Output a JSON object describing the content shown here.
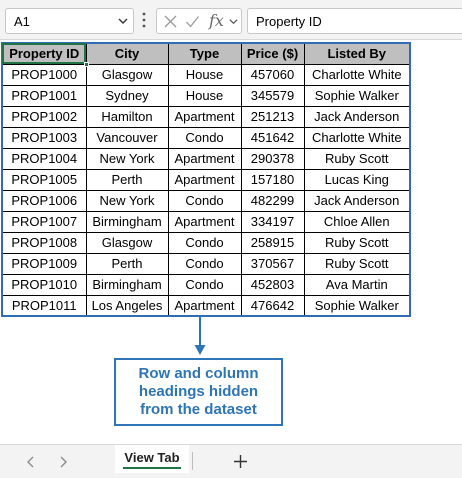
{
  "formula_bar": {
    "name_box": "A1",
    "formula": "Property ID",
    "fx_label": "fx"
  },
  "table": {
    "headers": [
      "Property ID",
      "City",
      "Type",
      "Price ($)",
      "Listed By"
    ],
    "rows": [
      [
        "PROP1000",
        "Glasgow",
        "House",
        "457060",
        "Charlotte White"
      ],
      [
        "PROP1001",
        "Sydney",
        "House",
        "345579",
        "Sophie Walker"
      ],
      [
        "PROP1002",
        "Hamilton",
        "Apartment",
        "251213",
        "Jack Anderson"
      ],
      [
        "PROP1003",
        "Vancouver",
        "Condo",
        "451642",
        "Charlotte White"
      ],
      [
        "PROP1004",
        "New York",
        "Apartment",
        "290378",
        "Ruby Scott"
      ],
      [
        "PROP1005",
        "Perth",
        "Apartment",
        "157180",
        "Lucas King"
      ],
      [
        "PROP1006",
        "New York",
        "Condo",
        "482299",
        "Jack Anderson"
      ],
      [
        "PROP1007",
        "Birmingham",
        "Apartment",
        "334197",
        "Chloe Allen"
      ],
      [
        "PROP1008",
        "Glasgow",
        "Condo",
        "258915",
        "Ruby Scott"
      ],
      [
        "PROP1009",
        "Perth",
        "Condo",
        "370567",
        "Ruby Scott"
      ],
      [
        "PROP1010",
        "Birmingham",
        "Condo",
        "452803",
        "Ava Martin"
      ],
      [
        "PROP1011",
        "Los Angeles",
        "Apartment",
        "476642",
        "Sophie Walker"
      ]
    ]
  },
  "annotation": {
    "text": "Row and column headings hidden from the dataset"
  },
  "sheet_tabs": {
    "active_tab": "View Tab"
  },
  "colors": {
    "header_fill": "#bfbfbf",
    "table_border": "#2f6db5",
    "callout": "#2e75b6",
    "excel_green": "#217346"
  },
  "icons": [
    "chevron-down-icon",
    "vertical-dots-icon",
    "cancel-x-icon",
    "check-icon",
    "chevron-left-icon",
    "chevron-right-icon",
    "plus-icon"
  ]
}
